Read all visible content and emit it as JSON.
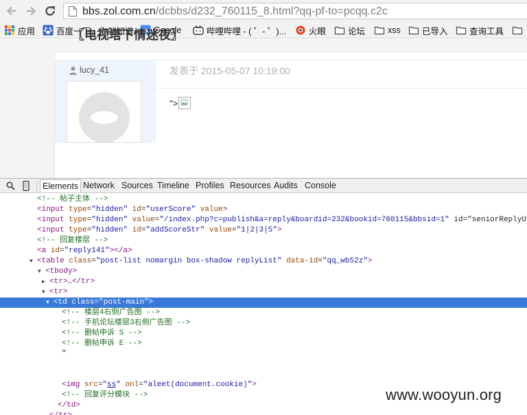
{
  "browser": {
    "url_host": "bbs.zol.com.cn",
    "url_rest": "/dcbbs/d232_760115_8.html?qq-pf-to=pcqq.c2c"
  },
  "bookmarks": [
    {
      "label": "应用",
      "icon": "apps-grid-icon"
    },
    {
      "label": "百度一下，你就知道",
      "icon": "baidu-paw-icon"
    },
    {
      "label": "Google",
      "icon": "google-icon"
    },
    {
      "label": "哔哩哔哩 - ( ゜- ゜)...",
      "icon": "bilibili-tv-icon"
    },
    {
      "label": "火眼",
      "icon": "fireeye-icon"
    },
    {
      "label": "论坛",
      "icon": "folder-icon"
    },
    {
      "label": "xss",
      "icon": "folder-icon"
    },
    {
      "label": "已导入",
      "icon": "folder-icon"
    },
    {
      "label": "查询工具",
      "icon": "folder-icon"
    }
  ],
  "post": {
    "title": "〖电视塔下情迷夜〗",
    "author": "lucy_41",
    "meta": "发表于 2015-05-07 10:19:00",
    "body_text": "\">"
  },
  "devtools": {
    "tabs": [
      "Elements",
      "Network",
      "Sources",
      "Timeline",
      "Profiles",
      "Resources",
      "Audits",
      "Console"
    ],
    "active_tab": "Elements",
    "lines": [
      {
        "indent": 4,
        "text": "<!-- 帖子主体 -->"
      },
      {
        "indent": 4,
        "text": "<input type=\"hidden\" id=\"userScore\" value>"
      },
      {
        "indent": 4,
        "text": "<input type=\"hidden\" value=\"/index.php?c=publish&a=reply&boardid=232&bookid=760115&bbsid=1\" id=\"seniorReplyUr"
      },
      {
        "indent": 4,
        "text": "<input type=\"hidden\" id=\"addScoreStr\" value=\"1|2|3|5\">"
      },
      {
        "indent": 4,
        "text": "<!-- 回复楼层 -->"
      },
      {
        "indent": 4,
        "text": "<a id=\"reply141\"></a>"
      },
      {
        "indent": 4,
        "text": "<table class=\"post-list nomargin box-shadow replyList\" data-id=\"qq_wb52z\">",
        "toggle": "open"
      },
      {
        "indent": 6,
        "text": "<tbody>",
        "toggle": "open"
      },
      {
        "indent": 7,
        "text": "<tr>…</tr>",
        "toggle": "closed"
      },
      {
        "indent": 7,
        "text": "<tr>",
        "toggle": "open"
      },
      {
        "indent": 8,
        "text": "<td class=\"post-main\">",
        "toggle": "open",
        "selected": true
      },
      {
        "indent": 10,
        "text": "<!-- 楼层4右侧广告图 -->"
      },
      {
        "indent": 10,
        "text": "<!-- 手机论坛楼层3右侧广告图 -->"
      },
      {
        "indent": 10,
        "text": "<!-- 删帖申诉 S -->"
      },
      {
        "indent": 10,
        "text": "<!-- 删帖申诉 E -->"
      },
      {
        "indent": 10,
        "text": "\""
      },
      {
        "indent": 10,
        "text": ""
      },
      {
        "indent": 10,
        "text": ""
      },
      {
        "indent": 10,
        "text": "<img src=\"ss\" onl=\"aleet(document.cookie)\">"
      },
      {
        "indent": 10,
        "text": "<!-- 回复评分模块 -->"
      },
      {
        "indent": 9,
        "text": "</td>"
      },
      {
        "indent": 7,
        "text": "</tr>"
      }
    ]
  },
  "watermark": "www.wooyun.org"
}
